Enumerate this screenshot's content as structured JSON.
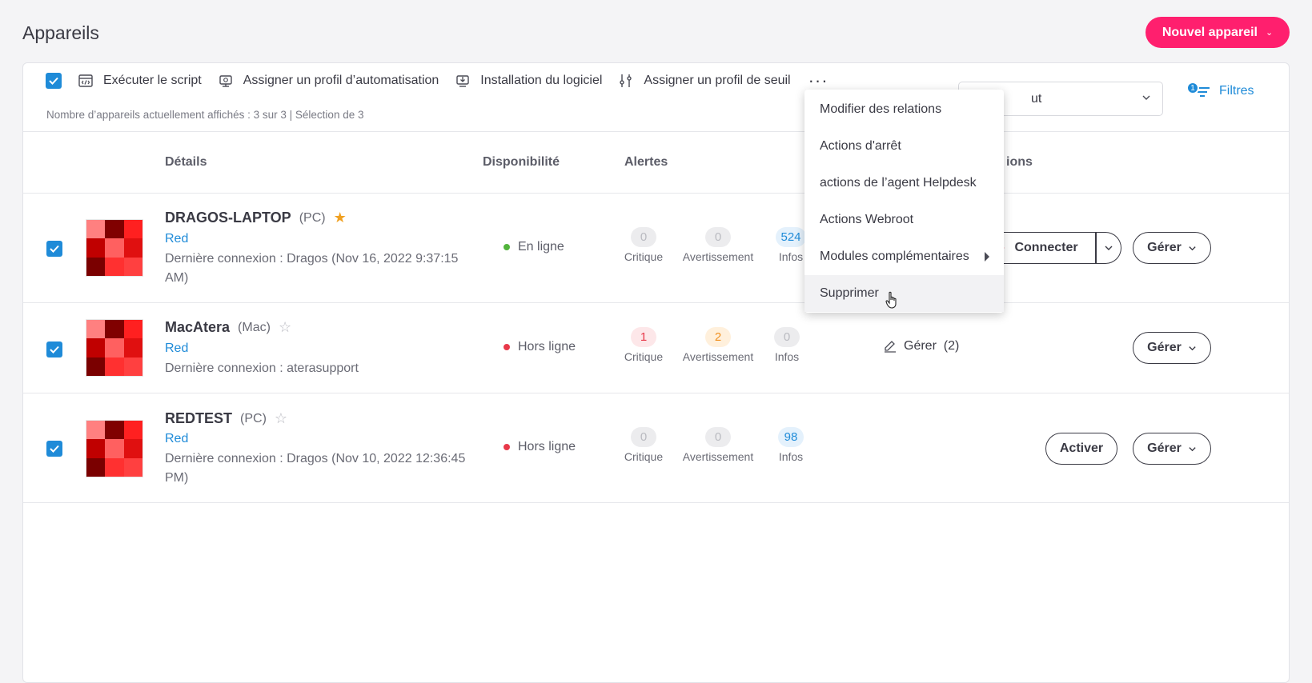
{
  "page": {
    "title": "Appareils",
    "new_device_label": "Nouvel appareil"
  },
  "toolbar": {
    "actions": [
      {
        "label": "Exécuter le script",
        "icon": "script-icon"
      },
      {
        "label": "Assigner un profil d’automatisation",
        "icon": "automation-profile-icon"
      },
      {
        "label": "Installation du logiciel",
        "icon": "software-install-icon"
      },
      {
        "label": "Assigner un profil de seuil",
        "icon": "threshold-icon"
      }
    ],
    "more_label": "···",
    "count_text": "Nombre d’appareils actuellement affichés : 3 sur 3 | Sélection de 3",
    "filter_select_value": "ut",
    "filters_label": "Filtres",
    "filters_badge": "1"
  },
  "columns": {
    "details": "Détails",
    "availability": "Disponibilité",
    "alerts": "Alertes",
    "actions_partial": "ions"
  },
  "alert_labels": {
    "critical": "Critique",
    "warning": "Avertissement",
    "info": "Infos"
  },
  "devices": [
    {
      "name": "DRAGOS-LAPTOP",
      "os": "(PC)",
      "favorite": true,
      "group": "Red",
      "last_login": "Dernière connexion : Dragos (Nov 16, 2022 9:37:15 AM)",
      "status": "En ligne",
      "status_color": "#52b43c",
      "critical": "0",
      "warning": "0",
      "info": "524",
      "primary_action": "Connecter",
      "manage": "Gérer"
    },
    {
      "name": "MacAtera",
      "os": "(Mac)",
      "favorite": false,
      "group": "Red",
      "last_login": "Dernière connexion : aterasupport",
      "status": "Hors ligne",
      "status_color": "#e8394a",
      "critical": "1",
      "warning": "2",
      "info": "0",
      "gerer_link": "Gérer  (2)",
      "manage": "Gérer"
    },
    {
      "name": "REDTEST",
      "os": "(PC)",
      "favorite": false,
      "group": "Red",
      "last_login": "Dernière connexion : Dragos (Nov 10, 2022 12:36:45 PM)",
      "status": "Hors ligne",
      "status_color": "#e8394a",
      "critical": "0",
      "warning": "0",
      "info": "98",
      "primary_action": "Activer",
      "manage": "Gérer"
    }
  ],
  "menu": {
    "items": [
      "Modifier des relations",
      "Actions d'arrêt",
      "actions de l’agent Helpdesk",
      "Actions Webroot",
      "Modules complémentaires",
      "Supprimer"
    ]
  },
  "colors": {
    "accent": "#1f8bd8",
    "brand": "#ff1f6e",
    "thumb_palette": [
      "#ff8080",
      "#800000",
      "#ff2020",
      "#c00000",
      "#ff6060",
      "#e01010",
      "#7a0000",
      "#ff3030",
      "#ff4040"
    ]
  }
}
